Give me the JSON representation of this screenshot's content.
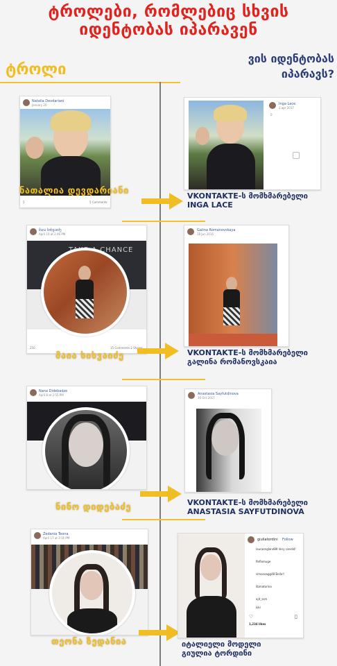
{
  "header": {
    "title": "ტროლები, რომლებიც სხვის იდენტობას იპარავენ",
    "left_label": "ტროლი",
    "right_label": "ვის იდენტობას იპარავს?"
  },
  "rows": [
    {
      "troll": {
        "name": "ნათალია დევდარიანი",
        "post_author": "Natalia Devdariani",
        "post_action": "added a new photo.",
        "post_date": "January 20",
        "footer_count": "5",
        "footer_comments": "5 Comments"
      },
      "victim": {
        "line1": "VKONTAKTE-ს მომხმარებელი",
        "line2": "INGA LACE",
        "profile_name": "Inga Lace",
        "profile_date": "1 apr 2017",
        "counter": "0"
      }
    },
    {
      "troll": {
        "name": "მაია სიხვაიძე",
        "post_author": "მაია სიხვაიძე",
        "post_action": "updated her profile picture.",
        "post_date": "April 10 at 2:46 PM",
        "footer_count": "250",
        "footer_comments": "15 Comments  2 Shares",
        "banner": "TAKE A CHANCE"
      },
      "victim": {
        "line1": "VKONTAKTE-ს მომხმარებელი",
        "line2": "გალინა რომანოვსკაია",
        "profile_name": "Galina Romanovskaya",
        "profile_date": "18 Jun 2015"
      }
    },
    {
      "troll": {
        "name": "ნინო დიდებაძე",
        "post_author": "Nana Didebadze",
        "post_action": "updated her profile picture.",
        "post_date": "April 8 at 2:55 PM"
      },
      "victim": {
        "line1": "VKONTAKTE-ს მომხმარებელი",
        "line2": "ANASTASIA SAYFUTDINOVA",
        "profile_name": "Anastasia Sayfutdinova",
        "profile_date": "30 Oct 2017"
      }
    },
    {
      "troll": {
        "name": "თეონა ზედანია",
        "post_author": "Zedania Teona",
        "post_action": "updated her profile picture.",
        "post_date": "April 17 at 3:11 PM"
      },
      "victim": {
        "line1": "იტალიელი მოდელი",
        "line2": "გიულია ტორდინი",
        "profile_name": "giuliatordini",
        "follow": "Follow",
        "likes": "1,234 likes",
        "comments": [
          "lauraengland89 Very candid!",
          "fleflamuge",
          "simoneagg48 Bella!!",
          "libmatorina",
          "ajit_ssm",
          "kiki"
        ]
      }
    }
  ],
  "colors": {
    "red": "#e0231e",
    "yellow": "#f0bd22",
    "navy": "#1f2f62",
    "fb_blue": "#365899"
  }
}
